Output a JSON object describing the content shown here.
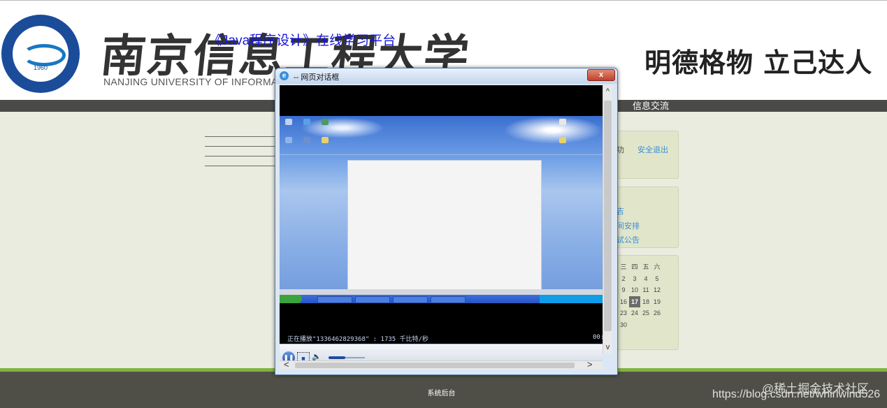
{
  "header": {
    "logo_year": "1960",
    "university_name_calligraphy": "南京信息工程大学",
    "university_name_english": "NANJING UNIVERSITY OF INFORMA",
    "course_title": "《Java程序设计》在线学习平台",
    "motto": "明德格物 立己达人"
  },
  "nav": {
    "exchange_label": "信息交流"
  },
  "side_panels": {
    "top": {
      "partial_label": "功",
      "logout_link": "安全退出"
    },
    "middle": {
      "partial_link_1": "吉",
      "partial_link_2": "间安排",
      "partial_link_3": "试公告"
    },
    "calendar": {
      "header": [
        "三",
        "四",
        "五",
        "六"
      ],
      "rows": [
        [
          "2",
          "3",
          "4",
          "5"
        ],
        [
          "9",
          "10",
          "11",
          "12"
        ],
        [
          "16",
          "17",
          "18",
          "19"
        ],
        [
          "23",
          "24",
          "25",
          "26"
        ],
        [
          "30",
          "",
          "",
          ""
        ]
      ],
      "today": "17"
    }
  },
  "dialog": {
    "title": "-- 网页对话框",
    "close_symbol": "x",
    "player": {
      "status_text": "正在播放\"1336462829368\" : 1735 千比特/秒",
      "time_text": "00:"
    },
    "scroll_up": "^",
    "scroll_down": "v",
    "scroll_left": "<",
    "scroll_right": ">"
  },
  "footer": {
    "admin_link": "系统后台"
  },
  "watermarks": {
    "line1": "@稀土掘金技术社区",
    "line2": "https://blog.csdn.net/whirlwind526"
  },
  "colors": {
    "nav_bg": "#4a4a48",
    "page_bg": "#e9ecdf",
    "footer_accent": "#7fb33f",
    "link": "#3b8fd6",
    "course_title": "#1515d9"
  },
  "icons": {
    "dialog": "ie-icon",
    "player_pause": "pause-icon",
    "player_stop": "stop-icon",
    "player_volume": "speaker-icon"
  }
}
